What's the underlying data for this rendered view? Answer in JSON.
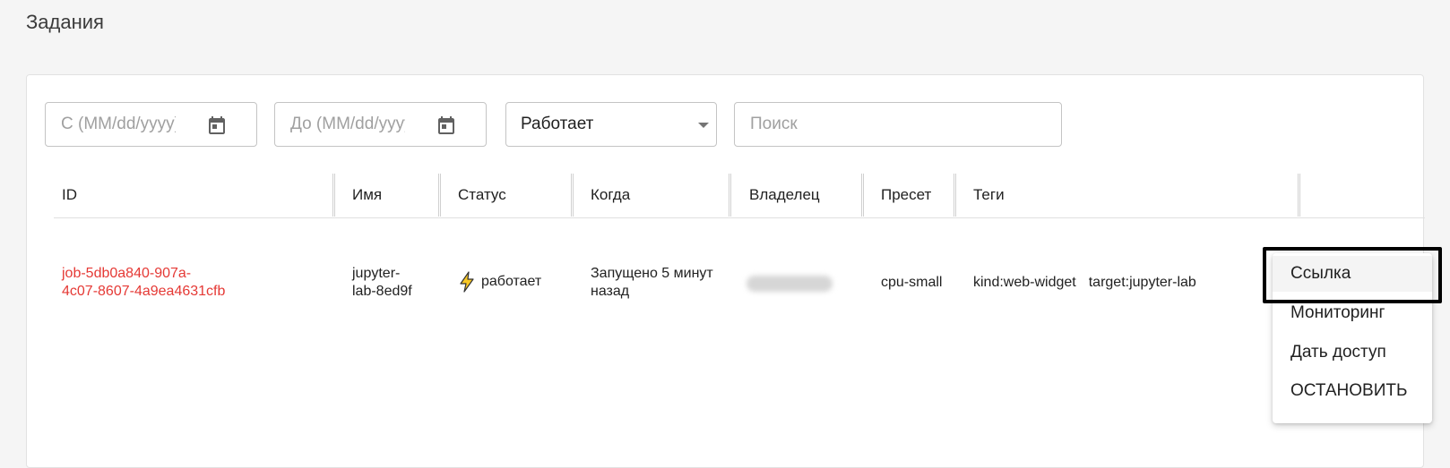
{
  "page": {
    "title": "Задания"
  },
  "filters": {
    "date_from_placeholder": "С (MM/dd/yyyy)",
    "date_to_placeholder": "До (MM/dd/yyyy)",
    "status_value": "Работает",
    "search_placeholder": "Поиск"
  },
  "table": {
    "columns": [
      "ID",
      "Имя",
      "Статус",
      "Когда",
      "Владелец",
      "Пресет",
      "Теги"
    ],
    "rows": [
      {
        "id_line1": "job-5db0a840-907a-",
        "id_line2": "4c07-8607-4a9ea4631cfb",
        "name_line1": "jupyter-",
        "name_line2": "lab-8ed9f",
        "status": "работает",
        "when_line1": "Запущено 5 минут",
        "when_line2": "назад",
        "preset": "cpu-small",
        "tags": [
          "kind:web-widget",
          "target:jupyter-lab"
        ]
      }
    ]
  },
  "menu": {
    "items": [
      "Ссылка",
      "Мониторинг",
      "Дать доступ",
      "ОСТАНОВИТЬ"
    ]
  },
  "colors": {
    "id_link": "#e53935",
    "status_icon": "#f9c825"
  },
  "icons": {
    "calendar": "calendar-icon",
    "status": "lightning-icon",
    "dropdown": "caret-down-icon"
  }
}
